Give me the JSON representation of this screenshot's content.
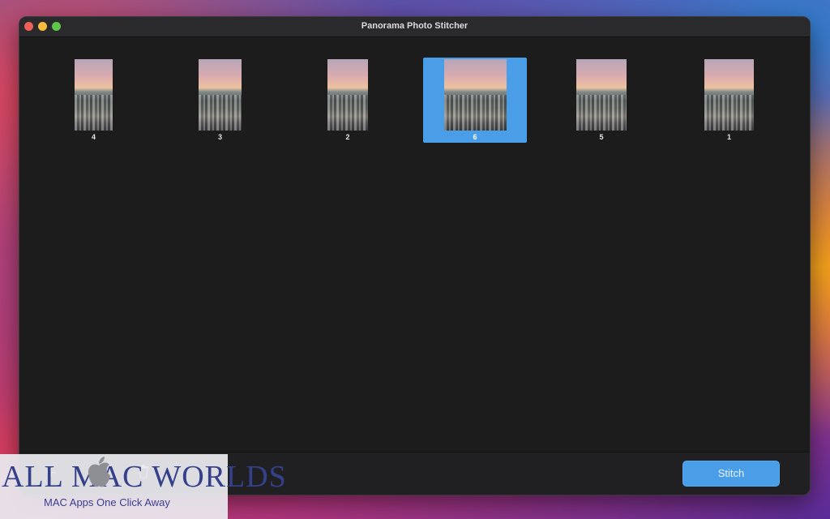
{
  "window": {
    "title": "Panorama Photo Stitcher"
  },
  "photos": [
    {
      "label": "4",
      "selected": false
    },
    {
      "label": "3",
      "selected": false
    },
    {
      "label": "2",
      "selected": false
    },
    {
      "label": "6",
      "selected": true
    },
    {
      "label": "5",
      "selected": false
    },
    {
      "label": "1",
      "selected": false
    }
  ],
  "toolbar": {
    "add_icon": "plus-icon",
    "remove_icon": "minus-icon",
    "delete_icon": "trash-icon",
    "stitch_label": "Stitch"
  },
  "watermark": {
    "title": "ALL MAC WORLDS",
    "subtitle": "MAC Apps One Click Away"
  },
  "colors": {
    "selection": "#4a9ee7",
    "window_bg": "#1c1c1d",
    "close": "#ee5f57",
    "minimize": "#f7bd3c",
    "maximize": "#5fc64a"
  }
}
